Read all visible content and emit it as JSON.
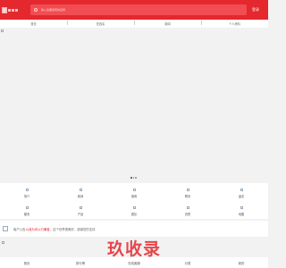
{
  "header": {
    "logo_icon": "broken-image-icon",
    "search_placeholder": "输入您要搜索的名称",
    "login_label": "登录"
  },
  "topnav": {
    "items": [
      "首页",
      "在线买",
      "新闻",
      "个人资料"
    ]
  },
  "banner": {
    "image_icon": "broken-image-icon",
    "dots": 3
  },
  "categories": {
    "items": [
      {
        "label": "简介",
        "icon": "broken-image-icon"
      },
      {
        "label": "新闻",
        "icon": "broken-image-icon"
      },
      {
        "label": "案例",
        "icon": "broken-image-icon"
      },
      {
        "label": "联系",
        "icon": "broken-image-icon"
      },
      {
        "label": "留言",
        "icon": "broken-image-icon"
      },
      {
        "label": "服务",
        "icon": "broken-image-icon"
      },
      {
        "label": "产品",
        "icon": "broken-image-icon"
      },
      {
        "label": "团队",
        "icon": "broken-image-icon"
      },
      {
        "label": "资质",
        "icon": "broken-image-icon"
      },
      {
        "label": "地图",
        "icon": "broken-image-icon"
      }
    ]
  },
  "news": {
    "prefix": "客户公告",
    "highlight": "以诚为本以行兼善",
    "suffix": "，这个世界很美好，感谢您的支持"
  },
  "watermark": {
    "text": "玖收录"
  },
  "tabbar": {
    "items": [
      "首页",
      "排行榜",
      "在线客服",
      "分类",
      "我的"
    ]
  },
  "colors": {
    "brand": "#e4282e",
    "background": "#f2f2f2"
  }
}
